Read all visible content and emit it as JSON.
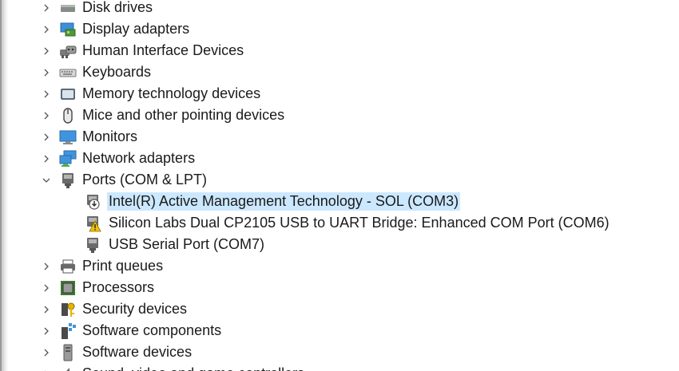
{
  "tree": {
    "items": [
      {
        "label": "Disk drives",
        "icon": "disk-drive-icon",
        "expanded": false
      },
      {
        "label": "Display adapters",
        "icon": "display-adapter-icon",
        "expanded": false
      },
      {
        "label": "Human Interface Devices",
        "icon": "hid-icon",
        "expanded": false
      },
      {
        "label": "Keyboards",
        "icon": "keyboard-icon",
        "expanded": false
      },
      {
        "label": "Memory technology devices",
        "icon": "memory-device-icon",
        "expanded": false
      },
      {
        "label": "Mice and other pointing devices",
        "icon": "mouse-icon",
        "expanded": false
      },
      {
        "label": "Monitors",
        "icon": "monitor-icon",
        "expanded": false
      },
      {
        "label": "Network adapters",
        "icon": "network-adapter-icon",
        "expanded": false
      },
      {
        "label": "Ports (COM & LPT)",
        "icon": "port-icon",
        "expanded": true
      },
      {
        "label": "Print queues",
        "icon": "printer-icon",
        "expanded": false
      },
      {
        "label": "Processors",
        "icon": "processor-icon",
        "expanded": false
      },
      {
        "label": "Security devices",
        "icon": "security-device-icon",
        "expanded": false
      },
      {
        "label": "Software components",
        "icon": "software-component-icon",
        "expanded": false
      },
      {
        "label": "Software devices",
        "icon": "software-device-icon",
        "expanded": false
      },
      {
        "label": "Sound, video and game controllers",
        "icon": "sound-icon",
        "expanded": false
      }
    ],
    "ports_children": [
      {
        "label": "Intel(R) Active Management Technology - SOL (COM3)",
        "icon": "port-download-icon",
        "selected": true
      },
      {
        "label": "Silicon Labs Dual CP2105 USB to UART Bridge: Enhanced COM Port (COM6)",
        "icon": "port-warning-icon",
        "selected": false
      },
      {
        "label": "USB Serial Port (COM7)",
        "icon": "port-icon",
        "selected": false
      }
    ]
  },
  "colors": {
    "selection": "#cce8ff",
    "text": "#1a1a1a",
    "warning": "#f2c200"
  }
}
